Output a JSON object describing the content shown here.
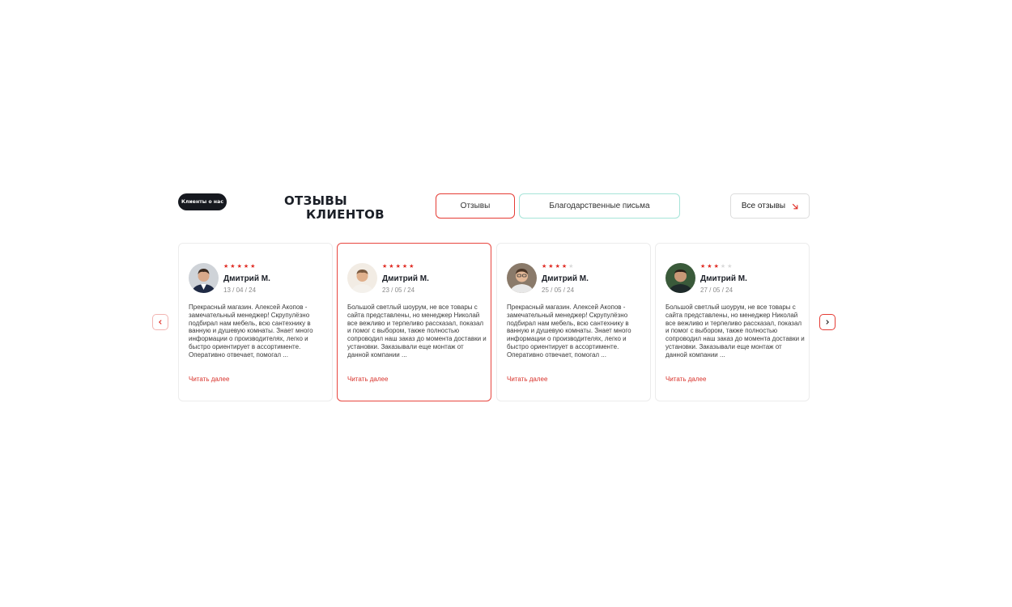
{
  "section": {
    "badge": "Клиенты о нас",
    "title_line1": "ОТЗЫВЫ",
    "title_line2": "КЛИЕНТОВ"
  },
  "tabs": [
    {
      "label": "Отзывы",
      "active": true
    },
    {
      "label": "Благодарственные письма",
      "active": false
    }
  ],
  "all_reviews": {
    "label": "Все отзывы",
    "icon": "arrow-down-right-icon"
  },
  "colors": {
    "accent": "#e02b23",
    "dark": "#16191f",
    "teal": "#a6e4d8"
  },
  "reviews": [
    {
      "name": "Дмитрий М.",
      "date": "13 / 04 / 24",
      "rating": 5,
      "text": "Прекрасный магазин. Алексей Акопов - замечательный менеджер! Скрупулёзно подбирал нам мебель, всю сантехнику в ванную и душевую комнаты. Знает много информации о производителях, легко и быстро ориентирует в ассортименте. Оперативно отвечает, помогал ...",
      "read_more": "Читать далее"
    },
    {
      "name": "Дмитрий М.",
      "date": "23 / 05 / 24",
      "rating": 5,
      "text": "Большой светлый шоурум, не все товары с сайта представлены, но менеджер Николай все вежливо и терпеливо рассказал, показал и помог с выбором, также полностью сопроводил наш заказ до момента доставки и установки. Заказывали еще монтаж от данной компании ...",
      "read_more": "Читать далее"
    },
    {
      "name": "Дмитрий М.",
      "date": "25 / 05 / 24",
      "rating": 4,
      "text": "Прекрасный магазин. Алексей Акопов - замечательный менеджер! Скрупулёзно подбирал нам мебель, всю сантехнику в ванную и душевую комнаты. Знает много информации о производителях, легко и быстро ориентирует в ассортименте. Оперативно отвечает, помогал ...",
      "read_more": "Читать далее"
    },
    {
      "name": "Дмитрий М.",
      "date": "27 / 05 / 24",
      "rating": 3,
      "text": "Большой светлый шоурум, не все товары с сайта представлены, но менеджер Николай все вежливо и терпеливо рассказал, показал и помог с выбором, также полностью сопроводил наш заказ до момента доставки и установки. Заказывали еще монтаж от данной компании ...",
      "read_more": "Читать далее"
    }
  ]
}
